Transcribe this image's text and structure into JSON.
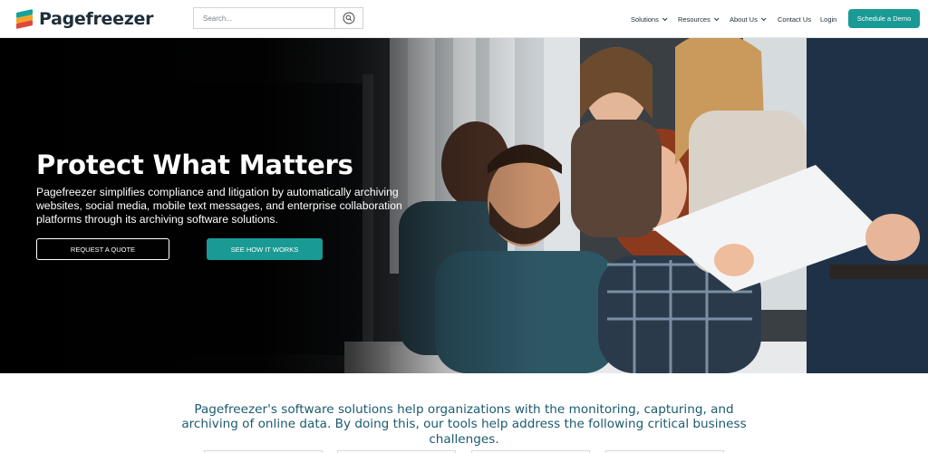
{
  "brand": {
    "name": "Pagefreezer",
    "colors": {
      "teal": "#1a9a94",
      "orange": "#f4a424",
      "red": "#e0473c",
      "text_dark": "#1f2d3a",
      "intro_text": "#1c5a6e"
    }
  },
  "header": {
    "search": {
      "placeholder": "Search...",
      "button_icon": "search-icon"
    },
    "nav": [
      {
        "label": "Solutions",
        "dropdown": true
      },
      {
        "label": "Resources",
        "dropdown": true
      },
      {
        "label": "About Us",
        "dropdown": true
      },
      {
        "label": "Contact Us",
        "dropdown": false
      },
      {
        "label": "Login",
        "dropdown": false
      }
    ],
    "cta_label": "Schedule a Demo"
  },
  "hero": {
    "title": "Protect What Matters",
    "subtitle": "Pagefreezer simplifies compliance and litigation by automatically archiving websites, social media, mobile text messages, and enterprise collaboration platforms through its archiving software solutions.",
    "buttons": {
      "quote": "REQUEST A QUOTE",
      "how": "SEE HOW IT WORKS"
    },
    "image": "photo of smiling office coworkers looking at a computer screen"
  },
  "intro": {
    "text": "Pagefreezer's software solutions help organizations with the monitoring, capturing, and archiving of online data. By doing this, our tools help address the following critical business challenges."
  }
}
